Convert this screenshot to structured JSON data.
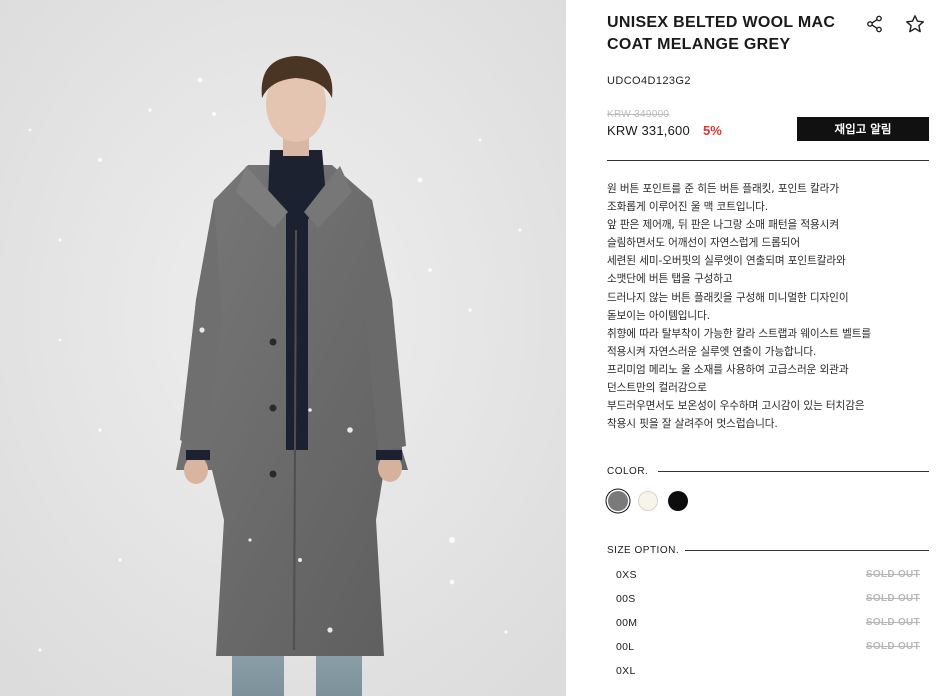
{
  "product": {
    "title": "UNISEX BELTED WOOL MAC COAT MELANGE GREY",
    "code": "UDCO4D123G2",
    "original_price": "KRW 349000",
    "sale_price": "KRW 331,600",
    "discount": "5%",
    "restock_button_label": "재입고 알림",
    "share_icon": "share-icon",
    "favorite_icon": "star-icon"
  },
  "description": [
    "원 버튼 포인트를 준 히든 버튼 플래킷, 포인트 칼라가",
    "조화롭게 이루어진 울 맥 코트입니다.",
    "앞 판은 제어깨, 뒤 판은 나그랑 소매 패턴을 적용시켜",
    "슬림하면서도 어깨선이 자연스럽게 드롭되어",
    "세련된 세미-오버핏의 실루엣이 연출되며 포인트칼라와",
    "소맷단에 버튼 탭을 구성하고",
    "드러나지 않는 버튼 플래킷을 구성해 미니멀한 디자인이",
    "돋보이는 아이템입니다.",
    "취향에 따라 탈부착이 가능한 칼라 스트랩과 웨이스트 벨트를",
    "적용시켜 자연스러운 실루엣 연출이 가능합니다.",
    "프리미엄 메리노 울 소재를 사용하여 고급스러운 외관과",
    "던스트만의 컬러감으로",
    "부드러우면서도 보온성이 우수하며 고시감이 있는 터치감은",
    "착용시 핏을 잘 살려주어 멋스럽습니다."
  ],
  "color_option": {
    "label": "COLOR.",
    "swatches": [
      {
        "name": "grey",
        "hex": "#7a7a7a",
        "selected": true
      },
      {
        "name": "ivory",
        "hex": "#f7f4ec",
        "selected": false
      },
      {
        "name": "black",
        "hex": "#0d0d0d",
        "selected": false
      }
    ]
  },
  "size_option": {
    "label": "SIZE OPTION.",
    "sizes": [
      {
        "name": "0XS",
        "status": "SOLD OUT"
      },
      {
        "name": "00S",
        "status": "SOLD OUT"
      },
      {
        "name": "00M",
        "status": "SOLD OUT"
      },
      {
        "name": "00L",
        "status": "SOLD OUT"
      },
      {
        "name": "0XL",
        "status": ""
      }
    ]
  },
  "colors": {
    "discount_red": "#e03131",
    "button_black": "#111111",
    "sold_out_grey": "#b8b8b8",
    "original_price_grey": "#bdbdbd"
  }
}
